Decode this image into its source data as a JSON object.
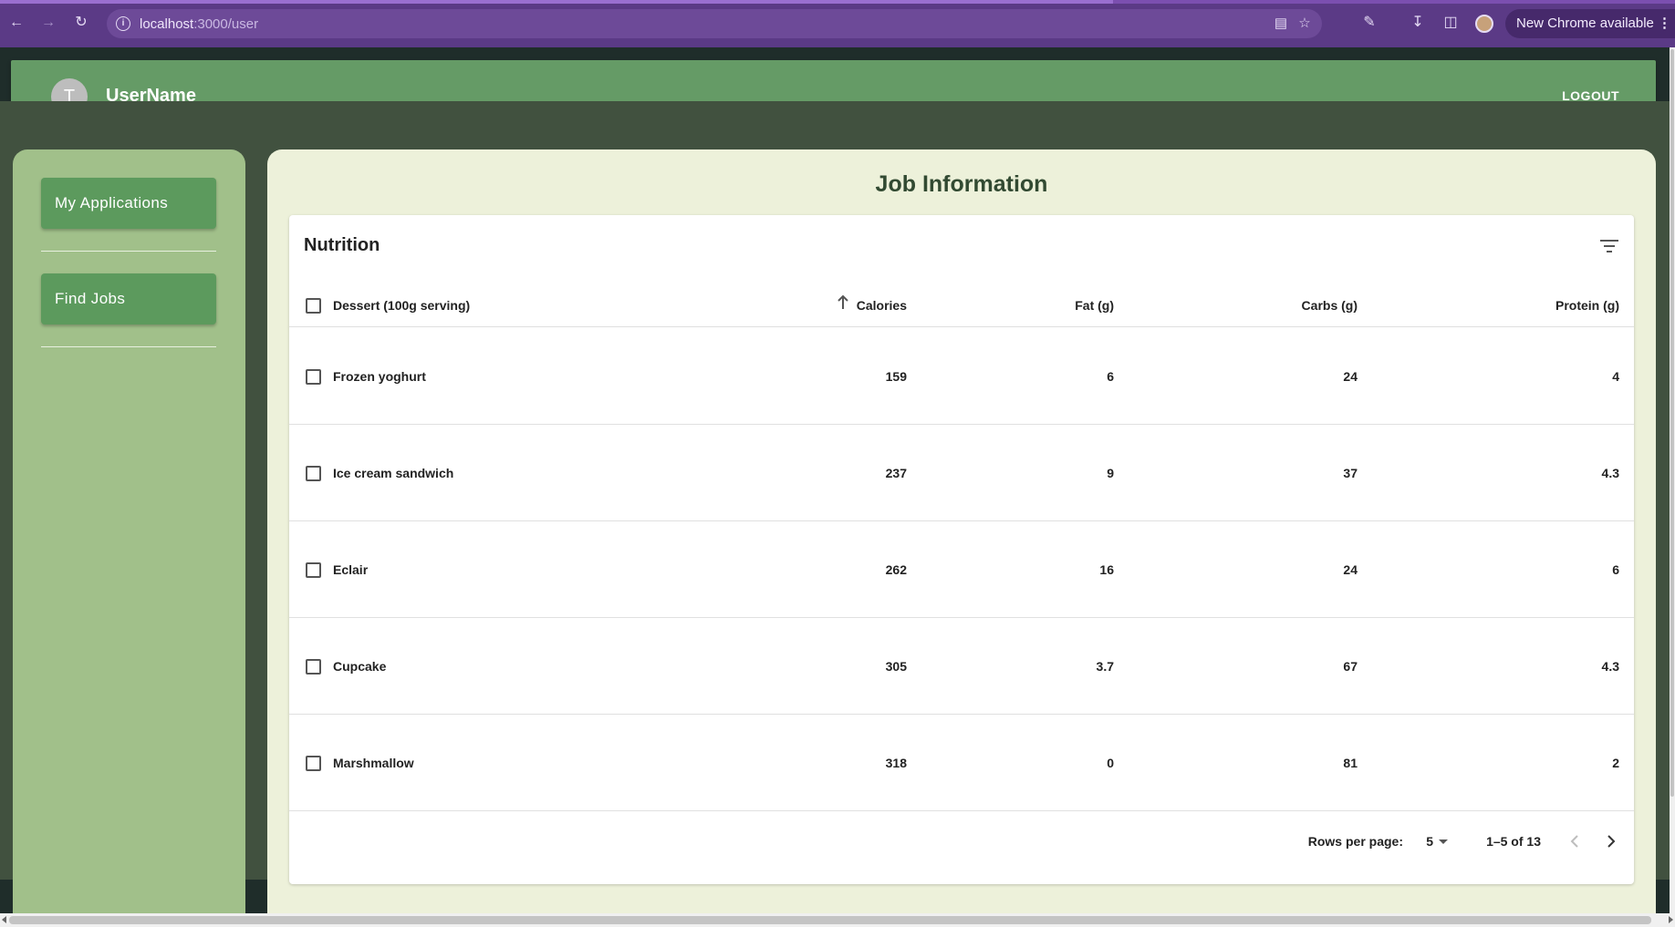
{
  "browser": {
    "url_host": "localhost",
    "url_path": ":3000/user",
    "update_label": "New Chrome available"
  },
  "appbar": {
    "avatar_letter": "T",
    "username": "UserName",
    "logout_label": "LOGOUT"
  },
  "sidebar": {
    "items": [
      {
        "label": "My Applications"
      },
      {
        "label": "Find Jobs"
      }
    ]
  },
  "main": {
    "title": "Job Information"
  },
  "table": {
    "title": "Nutrition",
    "columns": [
      "Dessert (100g serving)",
      "Calories",
      "Fat (g)",
      "Carbs (g)",
      "Protein (g)"
    ],
    "sort_column": "Calories",
    "sort_direction": "ascending",
    "rows": [
      {
        "name": "Frozen yoghurt",
        "calories": "159",
        "fat": "6",
        "carbs": "24",
        "protein": "4"
      },
      {
        "name": "Ice cream sandwich",
        "calories": "237",
        "fat": "9",
        "carbs": "37",
        "protein": "4.3"
      },
      {
        "name": "Eclair",
        "calories": "262",
        "fat": "16",
        "carbs": "24",
        "protein": "6"
      },
      {
        "name": "Cupcake",
        "calories": "305",
        "fat": "3.7",
        "carbs": "67",
        "protein": "4.3"
      },
      {
        "name": "Marshmallow",
        "calories": "318",
        "fat": "0",
        "carbs": "81",
        "protein": "2"
      }
    ],
    "pagination": {
      "rows_per_page_label": "Rows per page:",
      "rows_per_page_value": "5",
      "range_label": "1–5 of 13"
    }
  },
  "colors": {
    "appbar": "#659b66",
    "sidebar": "#a1c08a",
    "sidebar_button": "#5c9a5d",
    "main_bg": "#edf1da",
    "browser_frame": "#5b3a86"
  }
}
